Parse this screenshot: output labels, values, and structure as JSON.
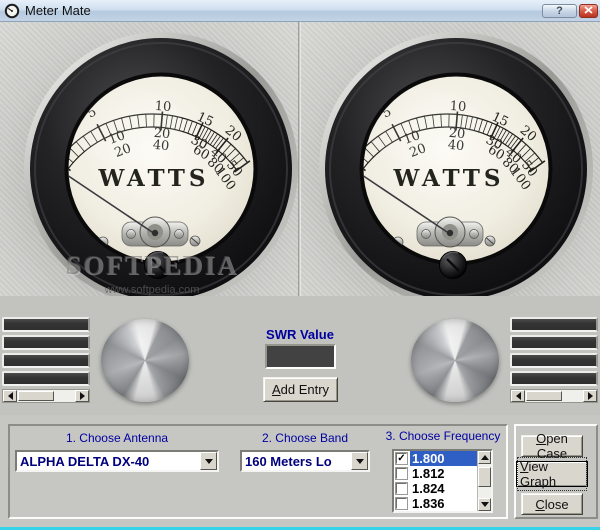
{
  "window": {
    "title": "Meter Mate",
    "help": "?",
    "close": "x"
  },
  "meter": {
    "unit": "WATTS",
    "scale_rows": {
      "top": [
        "5",
        "10",
        "15",
        "20"
      ],
      "middle": [
        "10",
        "20",
        "30",
        "40",
        "50"
      ],
      "bottom": [
        "20",
        "40",
        "60",
        "80",
        "100"
      ]
    }
  },
  "watermark": {
    "name": "SOFTPEDIA",
    "site": "www.softpedia.com"
  },
  "swr": {
    "label": "SWR Value",
    "value": ""
  },
  "buttons": {
    "add_entry": {
      "accel": "A",
      "rest": "dd Entry"
    },
    "open_case": {
      "accel": "O",
      "rest": "pen Case"
    },
    "view_graph": {
      "accel": "V",
      "rest": "iew Graph"
    },
    "close": {
      "accel": "C",
      "rest": "lose"
    }
  },
  "selectors": {
    "antenna": {
      "label": "1. Choose Antenna",
      "value": "ALPHA DELTA DX-40"
    },
    "band": {
      "label": "2. Choose Band",
      "value": "160 Meters Lo"
    },
    "frequency": {
      "label": "3. Choose Frequency",
      "items": [
        {
          "value": "1.800",
          "checked": true,
          "selected": true
        },
        {
          "value": "1.812",
          "checked": false,
          "selected": false
        },
        {
          "value": "1.824",
          "checked": false,
          "selected": false
        },
        {
          "value": "1.836",
          "checked": false,
          "selected": false
        }
      ]
    }
  },
  "icons": {
    "check": "✓"
  },
  "colors": {
    "label_navy": "#0000a0",
    "value_navy": "#00007c",
    "selection_blue": "#2f5fc4",
    "close_red": "#c94f3f",
    "frame_cyan": "#35d2e8",
    "swr_display_bg": "#424242",
    "titlebar_top": "#e7f0fa",
    "titlebar_bottom": "#b5c9de"
  }
}
